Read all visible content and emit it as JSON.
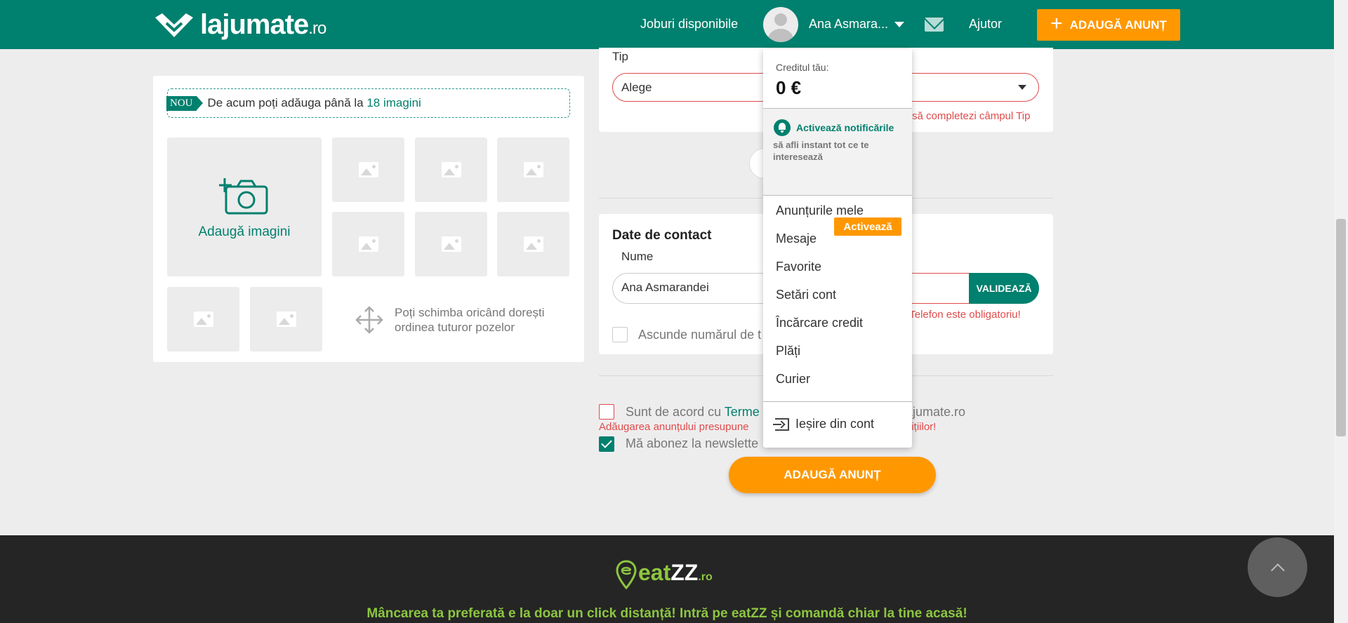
{
  "header": {
    "logo_main": "lajumate",
    "logo_tld": ".ro",
    "jobs_link": "Joburi disponibile",
    "user_name": "Ana Asmara...",
    "help_link": "Ajutor",
    "add_button": "ADAUGĂ ANUNȚ"
  },
  "photos": {
    "nou_tag": "NOU",
    "banner_text": "De acum poți adăuga până la ",
    "banner_highlight": "18 imagini",
    "add_images_label": "Adaugă imagini",
    "reorder_hint": "Poți schimba oricând dorești ordinea tuturor pozelor"
  },
  "form": {
    "tip_label": "Tip",
    "tip_value": "Alege",
    "tip_error": "să completezi câmpul Tip",
    "contact_title": "Date de contact",
    "name_label": "Nume",
    "name_value": "Ana Asmarandei",
    "validate_button": "VALIDEAZĂ",
    "phone_error": "l Telefon este obligatoriu!",
    "hide_phone_label": "Ascunde numărul de t",
    "terms_prefix": "Sunt de acord cu ",
    "terms_link": "Terme",
    "terms_suffix": "ajumate.ro",
    "terms_error_left": "Adăugarea anunțului presupune",
    "terms_error_right": "dițiilor!",
    "newsletter_label": "Mă abonez la newslette",
    "submit_button": "ADAUGĂ ANUNȚ"
  },
  "dropdown": {
    "credit_label": "Creditul tău:",
    "credit_value": "0 €",
    "notif_title": "Activează notificările",
    "notif_desc": "să afli instant tot ce te interesează",
    "notif_button": "Activează",
    "items": [
      "Anunțurile mele",
      "Mesaje",
      "Favorite",
      "Setări cont",
      "Încărcare credit",
      "Plăți",
      "Curier"
    ],
    "logout": "Ieșire din cont"
  },
  "footer": {
    "logo_main": "eat",
    "logo_zz": "ZZ",
    "logo_tld": ".ro",
    "tagline": "Mâncarea ta preferată e la doar un click distanță! Intră pe eatZZ și comandă chiar la tine acasă!"
  },
  "colors": {
    "brand": "#00806e",
    "accent": "#ff9800",
    "error": "#e04b4b",
    "eatzz_green": "#8cc63f"
  }
}
